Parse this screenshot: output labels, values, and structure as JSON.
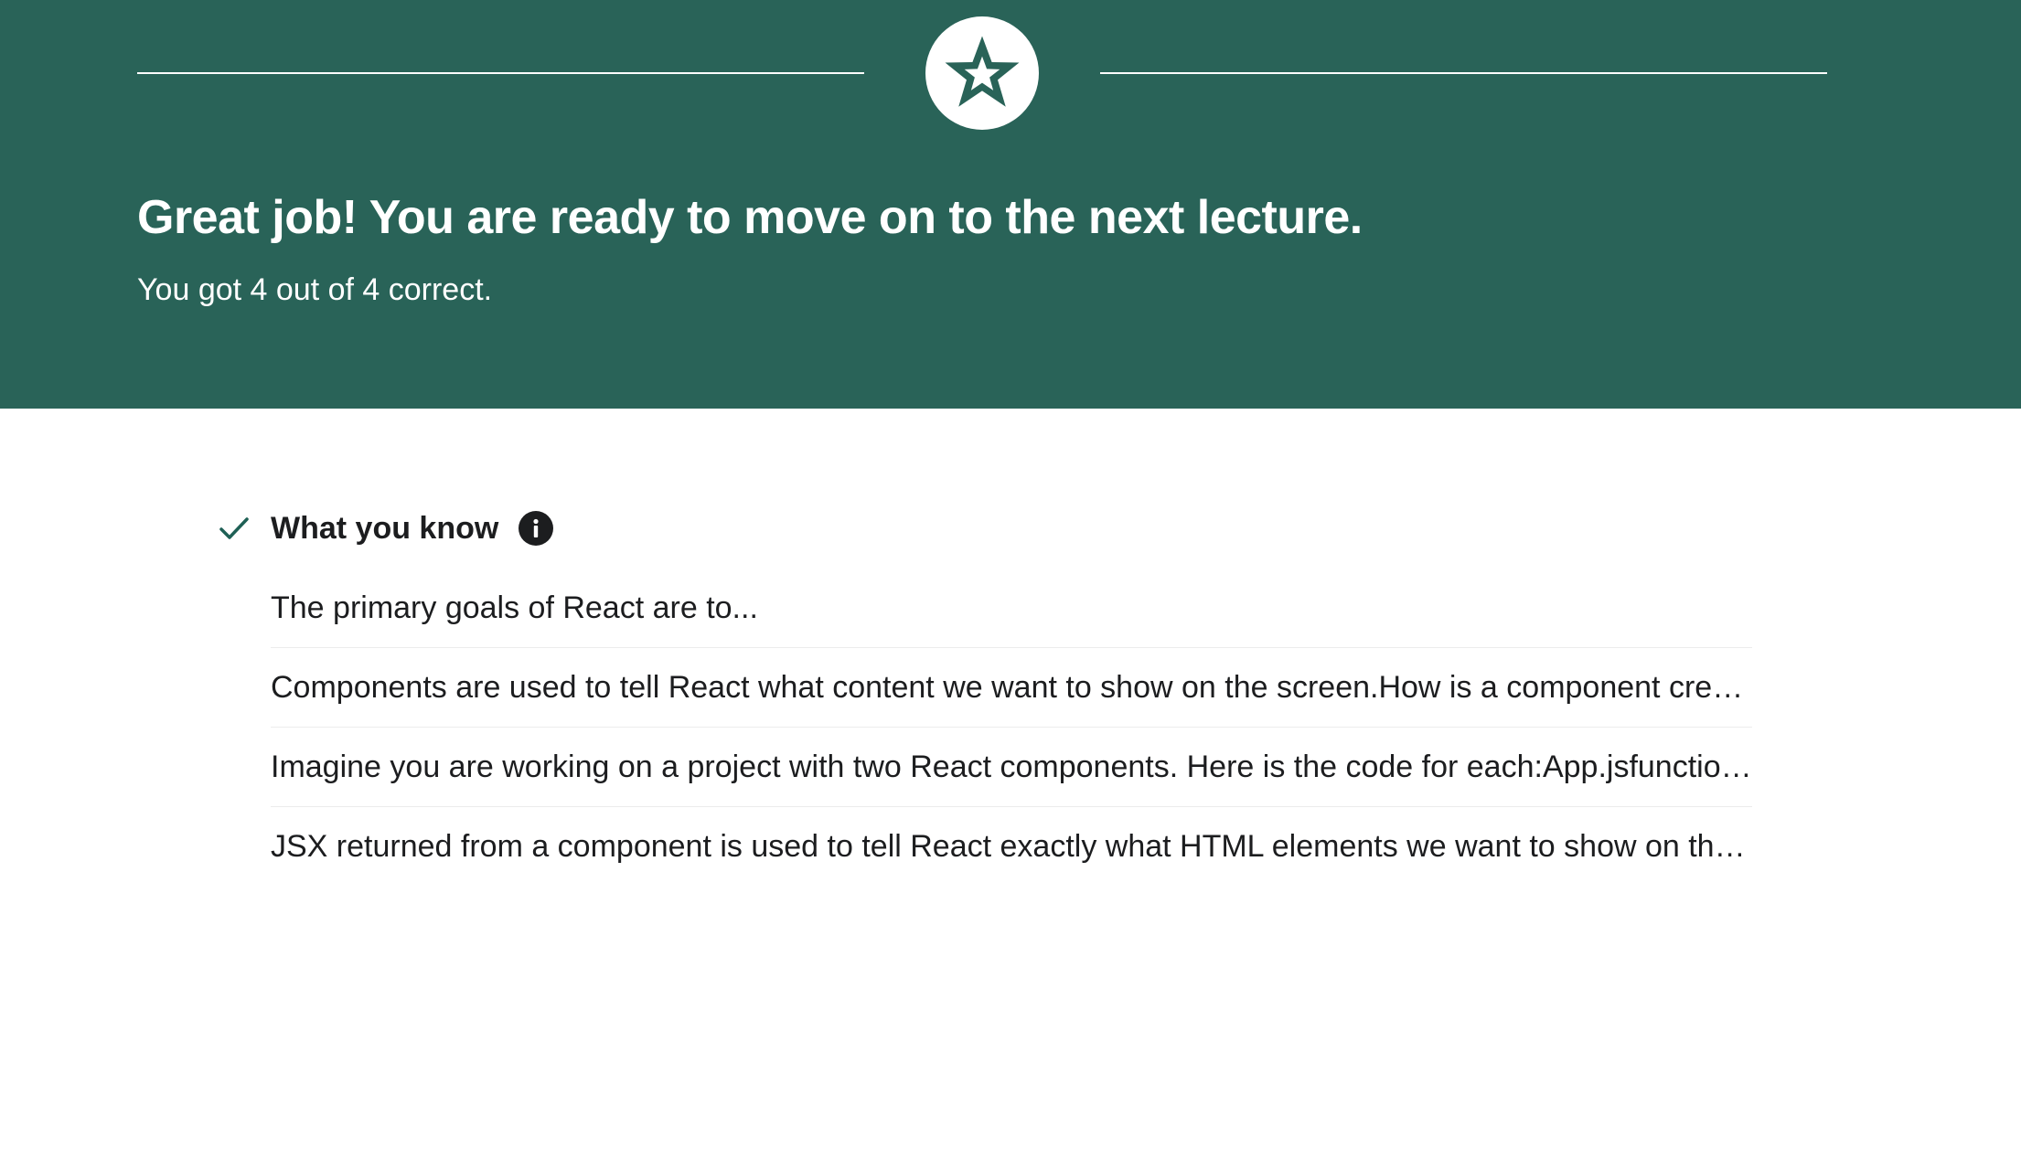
{
  "banner": {
    "headline": "Great job! You are ready to move on to the next lecture.",
    "score_text": "You got 4 out of 4 correct.",
    "background_color": "#296358",
    "badge_icon": "star-icon"
  },
  "knowledge": {
    "title": "What you know",
    "status_icon": "check-icon",
    "info_icon": "info-icon",
    "accent_color": "#1e6055",
    "items": [
      {
        "text": "The primary goals of React are to..."
      },
      {
        "text": "Components are used to tell React what content we want to show on the screen.How is a component created in React?"
      },
      {
        "text": "Imagine you are working on a project with two React components.  Here is the code for each:App.jsfunction App() {}"
      },
      {
        "text": "JSX returned from a component is used to tell React exactly what HTML elements we want to show on the screen."
      }
    ]
  }
}
